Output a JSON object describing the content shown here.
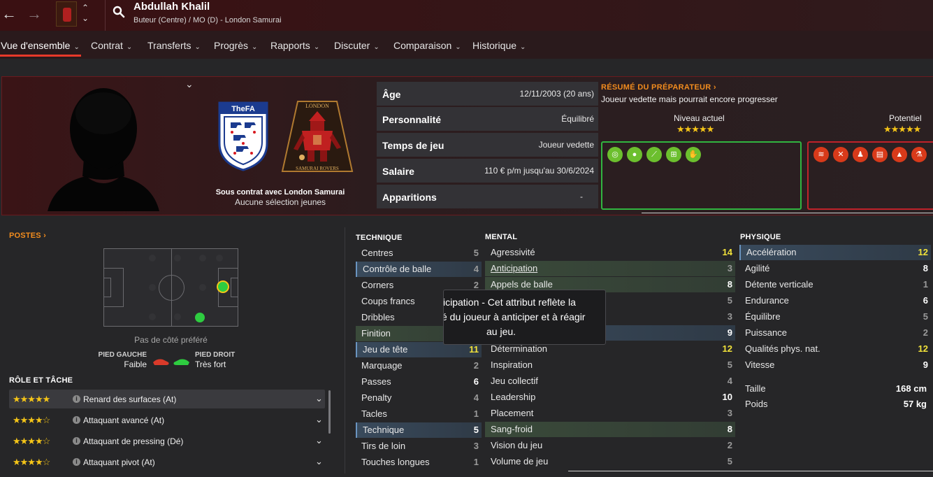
{
  "header": {
    "player_name": "Abdullah Khalil",
    "player_sub": "Buteur (Centre) / MO (D) - London Samurai",
    "nav_back": "←",
    "nav_forward": "→",
    "up": "⌃",
    "down": "⌄"
  },
  "tabs": [
    {
      "label": "Vue d'ensemble"
    },
    {
      "label": "Contrat"
    },
    {
      "label": "Transferts"
    },
    {
      "label": "Progrès"
    },
    {
      "label": "Rapports"
    },
    {
      "label": "Discuter"
    },
    {
      "label": "Comparaison"
    },
    {
      "label": "Historique"
    }
  ],
  "profile": {
    "fa_text": "TheFA",
    "club_top": "LONDON",
    "club_bottom": "SAMURAI ROVERS",
    "contract_text": "Sous contrat avec London Samurai",
    "youth_text": "Aucune sélection jeunes",
    "info": [
      {
        "label": "Âge",
        "value": "12/11/2003 (20 ans)"
      },
      {
        "label": "Personnalité",
        "value": "Équilibré"
      },
      {
        "label": "Temps de jeu",
        "value": "Joueur vedette"
      },
      {
        "label": "Salaire",
        "value": "110 € p/m jusqu'au 30/6/2024"
      },
      {
        "label": "Apparitions",
        "value": "-"
      }
    ]
  },
  "scout": {
    "title": "RÉSUMÉ DU PRÉPARATEUR ›",
    "summary": "Joueur vedette mais pourrait encore progresser",
    "current_label": "Niveau actuel",
    "current_stars": "★★★★★",
    "potential_label": "Potentiel",
    "potential_stars": "★★★★★",
    "strength_icons": [
      "target-icon",
      "brain-icon",
      "boot-icon",
      "goal-icon",
      "handshake-icon"
    ],
    "weakness_icons": [
      "spring-icon",
      "tackle-icon",
      "foot-icon",
      "clipboard-icon",
      "cone-icon",
      "flask-icon"
    ]
  },
  "positions": {
    "title": "POSTES ›",
    "side_text": "Pas de côté préféré",
    "left_foot_label": "PIED GAUCHE",
    "left_foot_value": "Faible",
    "right_foot_label": "PIED DROIT",
    "right_foot_value": "Très fort"
  },
  "roles": {
    "title": "RÔLE ET TÂCHE",
    "items": [
      {
        "stars": "★★★★★",
        "name": "Renard des surfaces (At)",
        "rating": 5
      },
      {
        "stars": "★★★★☆",
        "name": "Attaquant avancé (At)",
        "rating": 4
      },
      {
        "stars": "★★★★☆",
        "name": "Attaquant de pressing (Dé)",
        "rating": 4
      },
      {
        "stars": "★★★★☆",
        "name": "Attaquant pivot (At)",
        "rating": 4
      }
    ]
  },
  "attributes": {
    "technique_title": "TECHNIQUE",
    "mental_title": "MENTAL",
    "physique_title": "PHYSIQUE",
    "technique": [
      {
        "name": "Centres",
        "value": "5"
      },
      {
        "name": "Contrôle de balle",
        "value": "4"
      },
      {
        "name": "Corners",
        "value": "2"
      },
      {
        "name": "Coups francs",
        "value": ""
      },
      {
        "name": "Dribbles",
        "value": ""
      },
      {
        "name": "Finition",
        "value": ""
      },
      {
        "name": "Jeu de tête",
        "value": "11"
      },
      {
        "name": "Marquage",
        "value": "2"
      },
      {
        "name": "Passes",
        "value": "6"
      },
      {
        "name": "Penalty",
        "value": "4"
      },
      {
        "name": "Tacles",
        "value": "1"
      },
      {
        "name": "Technique",
        "value": "5"
      },
      {
        "name": "Tirs de loin",
        "value": "3"
      },
      {
        "name": "Touches longues",
        "value": "1"
      }
    ],
    "mental": [
      {
        "name": "Agressivité",
        "value": "14"
      },
      {
        "name": "Anticipation",
        "value": "3"
      },
      {
        "name": "Appels de balle",
        "value": "8"
      },
      {
        "name": "",
        "value": "5"
      },
      {
        "name": "",
        "value": "3"
      },
      {
        "name": "",
        "value": "9"
      },
      {
        "name": "Détermination",
        "value": "12"
      },
      {
        "name": "Inspiration",
        "value": "5"
      },
      {
        "name": "Jeu collectif",
        "value": "4"
      },
      {
        "name": "Leadership",
        "value": "10"
      },
      {
        "name": "Placement",
        "value": "3"
      },
      {
        "name": "Sang-froid",
        "value": "8"
      },
      {
        "name": "Vision du jeu",
        "value": "2"
      },
      {
        "name": "Volume de jeu",
        "value": "5"
      }
    ],
    "physique": [
      {
        "name": "Accélération",
        "value": "12"
      },
      {
        "name": "Agilité",
        "value": "8"
      },
      {
        "name": "Détente verticale",
        "value": "1"
      },
      {
        "name": "Endurance",
        "value": "6"
      },
      {
        "name": "Équilibre",
        "value": "5"
      },
      {
        "name": "Puissance",
        "value": "2"
      },
      {
        "name": "Qualités phys. nat.",
        "value": "12"
      },
      {
        "name": "Vitesse",
        "value": "9"
      }
    ],
    "height_label": "Taille",
    "height_value": "168 cm",
    "weight_label": "Poids",
    "weight_value": "57 kg"
  },
  "tooltip": {
    "line1": "icipation - Cet attribut reflète la",
    "line2": "é du joueur à anticiper et à réagir",
    "line3": "au jeu."
  },
  "colors": {
    "accent_red": "#e8392a",
    "orange_title": "#f28c1e",
    "star_yellow": "#f5c518",
    "highlight_value": "#f1e23a",
    "strength_green": "#31b540",
    "weakness_red": "#c0222a"
  }
}
